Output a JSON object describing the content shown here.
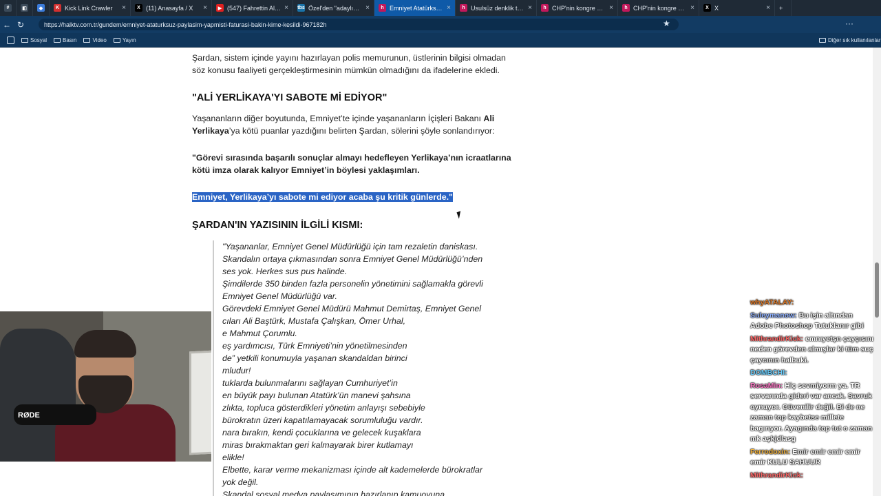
{
  "browser": {
    "tabs": [
      {
        "label": "",
        "fav": "#",
        "color": "#3b4a59"
      },
      {
        "label": "",
        "fav": "◧",
        "color": "#3b4a59"
      },
      {
        "label": "",
        "fav": "◆",
        "color": "#3b7bd9"
      },
      {
        "label": "Kick Link Crawler",
        "fav": "K",
        "color": "#d23030"
      },
      {
        "label": "(11) Anasayfa / X",
        "fav": "X",
        "color": "#000000"
      },
      {
        "label": "(547) Fahrettin Altun",
        "fav": "▶",
        "color": "#e02020"
      },
      {
        "label": "Özel'den \"adaylık\" so",
        "fav": "tbs",
        "color": "#1a73a8"
      },
      {
        "label": "Emniyet Atatürksüz p",
        "fav": "h",
        "color": "#c2185b",
        "active": true
      },
      {
        "label": "Usulsüz denklik tarife",
        "fav": "h",
        "color": "#c2185b"
      },
      {
        "label": "CHP'nin kongre süreci",
        "fav": "h",
        "color": "#c2185b"
      },
      {
        "label": "CHP'nin kongre süreci",
        "fav": "h",
        "color": "#c2185b"
      },
      {
        "label": "X",
        "fav": "X",
        "color": "#000000"
      }
    ],
    "url": "https://halktv.com.tr/gundem/emniyet-ataturksuz-paylasim-yapmisti-faturasi-bakin-kime-kesildi-967182h",
    "bookmarks": [
      "Sosyal",
      "Basın",
      "Video",
      "Yayın"
    ],
    "other_bookmarks": "Diğer sık kullanılanlar"
  },
  "article": {
    "p1": "Şardan, sistem içinde yayını hazırlayan polis memurunun, üstlerinin bilgisi olmadan söz konusu faaliyeti gerçekleştirmesinin mümkün olmadığını da ifadelerine ekledi.",
    "h1": "\"ALİ YERLİKAYA'YI SABOTE Mİ EDİYOR\"",
    "p2_a": "Yaşananların diğer boyutunda, Emniyet’te içinde yaşananların İçişleri Bakanı ",
    "p2_b": "Ali Yerlikaya",
    "p2_c": "’ya kötü puanlar yazdığını belirten Şardan, sölerini şöyle sonlandırıyor:",
    "p3": "\"Görevi sırasında başarılı sonuçlar almayı hedefleyen Yerlikaya’nın icraatlarına kötü imza olarak kalıyor Emniyet’in böylesi yaklaşımları.",
    "p4": "Emniyet, Yerlikaya’yı sabote mi ediyor acaba şu kritik günlerde.\"",
    "h2": "ŞARDAN'IN YAZISININ İLGİLİ KISMI:",
    "quote": [
      "\"Yaşananlar, Emniyet Genel Müdürlüğü için tam rezaletin daniskası.",
      "Skandalın ortaya çıkmasından sonra Emniyet Genel Müdürlüğü’nden",
      "ses yok. Herkes sus pus halinde.",
      "Şimdilerde 350 binden fazla personelin yönetimini sağlamakla görevli",
      "Emniyet Genel Müdürlüğü var.",
      "Görevdeki Emniyet Genel Müdürü Mahmut Demirtaş, Emniyet Genel",
      "cıları Ali Baştürk, Mustafa Çalışkan, Ömer Urhal,",
      "e Mahmut Çorumlu.",
      "eş yardımcısı, Türk Emniyeti’nin yönetilmesinden",
      "de” yetkili konumuyla yaşanan skandaldan birinci",
      "mludur!",
      "tuklarda bulunmalarını sağlayan Cumhuriyet’in",
      "en büyük payı bulunan Atatürk’ün manevi şahsına",
      "zlıkta, topluca gösterdikleri yönetim anlayışı sebebiyle",
      "bürokratın üzeri kapatılamayacak sorumluluğu vardır.",
      "nara bırakın, kendi çocuklarına ve gelecek kuşaklara",
      "miras bırakmaktan geri kalmayarak birer kutlamayı",
      "elikle!",
      "Elbette, karar verme mekanizması içinde alt kademelerde bürokratlar",
      "yok değil.",
      "Skandal sosyal medya paylaşımının hazırlanıp kamuoyuna"
    ]
  },
  "chat": [
    {
      "user": "whyATALAY:",
      "text": "",
      "color": "#e07a28"
    },
    {
      "user": "Suleymanow:",
      "text": "Bu işin altından Adobe Photoshop Tutuklanır gibi",
      "color": "#8fb1ff"
    },
    {
      "user": "MithrandirKick:",
      "text": "emnıyetşn çayçısını neden görevden almışlar ki tüm suç çaycının halbuki.",
      "color": "#ff6b6b"
    },
    {
      "user": "DOMBCHI:",
      "text": "",
      "color": "#6cd0ff"
    },
    {
      "user": "RosaMin:",
      "text": "Hiç sevmiyorm ya. TR servarında gideri var ancak. Savruk oynuyor. Güvenilir değil. Bi de ne zaman top kaybetse millete bagırıyor. Ayagında top tut o zaman mk aşkjdlasg",
      "color": "#ff7ac8"
    },
    {
      "user": "Ferrodoxin:",
      "text": "Emir emir emir emir emir KULU SAHUUR",
      "color": "#f5b53f"
    },
    {
      "user": "MithrandirKick:",
      "text": "",
      "color": "#ff6b6b"
    }
  ],
  "webcam": {
    "mic_brand": "RØDE"
  },
  "colors": {
    "highlight": "#2a64c5",
    "tab_active": "#0f5aa8"
  }
}
